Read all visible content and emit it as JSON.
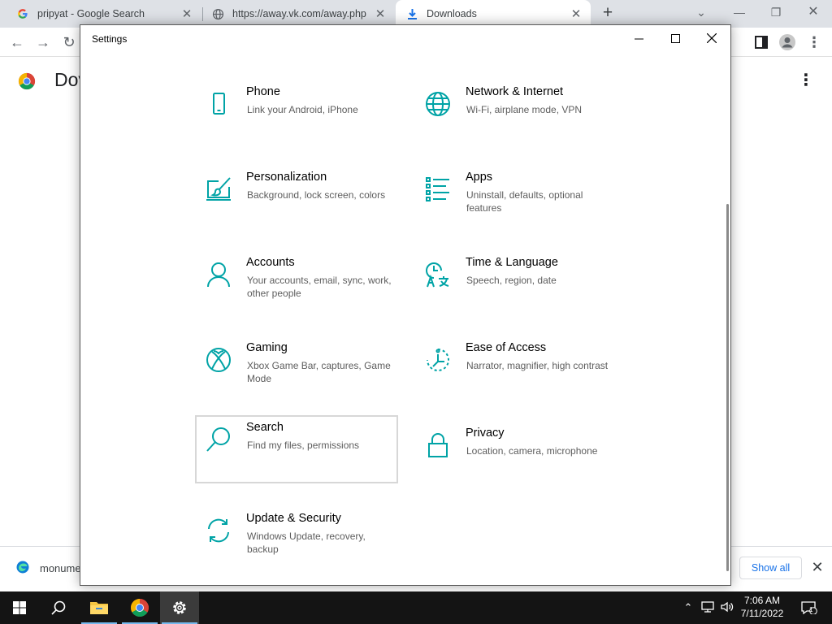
{
  "browser": {
    "tabs": [
      {
        "title": "pripyat - Google Search",
        "icon": "google-icon"
      },
      {
        "title": "https://away.vk.com/away.php",
        "icon": "globe-icon"
      },
      {
        "title": "Downloads",
        "icon": "download-icon"
      }
    ],
    "page_title": "Downloads",
    "page_title_visible": "Dov",
    "downloads_bar": {
      "file_name": "monume",
      "show_all_label": "Show all"
    }
  },
  "settings": {
    "window_title": "Settings",
    "accent_color": "#00a3a6",
    "categories": [
      {
        "name": "Phone",
        "desc": "Link your Android, iPhone",
        "icon": "phone-icon"
      },
      {
        "name": "Network & Internet",
        "desc": "Wi-Fi, airplane mode, VPN",
        "icon": "globe-icon"
      },
      {
        "name": "Personalization",
        "desc": "Background, lock screen, colors",
        "icon": "paintbrush-icon"
      },
      {
        "name": "Apps",
        "desc": "Uninstall, defaults, optional features",
        "icon": "apps-list-icon"
      },
      {
        "name": "Accounts",
        "desc": "Your accounts, email, sync, work, other people",
        "icon": "person-icon"
      },
      {
        "name": "Time & Language",
        "desc": "Speech, region, date",
        "icon": "time-language-icon"
      },
      {
        "name": "Gaming",
        "desc": "Xbox Game Bar, captures, Game Mode",
        "icon": "xbox-icon"
      },
      {
        "name": "Ease of Access",
        "desc": "Narrator, magnifier, high contrast",
        "icon": "ease-of-access-icon"
      },
      {
        "name": "Search",
        "desc": "Find my files, permissions",
        "icon": "search-icon"
      },
      {
        "name": "Privacy",
        "desc": "Location, camera, microphone",
        "icon": "lock-icon"
      },
      {
        "name": "Update & Security",
        "desc": "Windows Update, recovery, backup",
        "icon": "sync-icon"
      }
    ]
  },
  "taskbar": {
    "time": "7:06 AM",
    "date": "7/11/2022",
    "notification_count": "1"
  }
}
